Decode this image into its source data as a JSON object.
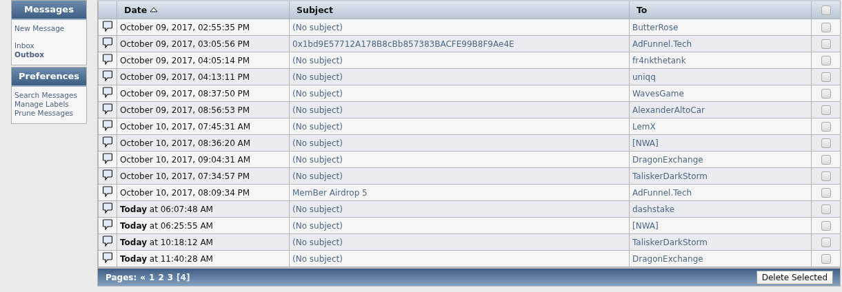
{
  "sidebar": {
    "sections": [
      {
        "title": "Messages",
        "groups": [
          [
            {
              "label": "New Message",
              "selected": false
            }
          ],
          [
            {
              "label": "Inbox",
              "selected": false
            },
            {
              "label": "Outbox",
              "selected": true
            }
          ]
        ]
      },
      {
        "title": "Preferences",
        "groups": [
          [
            {
              "label": "Search Messages",
              "selected": false
            },
            {
              "label": "Manage Labels",
              "selected": false
            },
            {
              "label": "Prune Messages",
              "selected": false
            }
          ]
        ]
      }
    ]
  },
  "table": {
    "columns": [
      {
        "label": "Date",
        "sorted": true
      },
      {
        "label": "Subject",
        "sorted": false
      },
      {
        "label": "To",
        "sorted": false
      }
    ],
    "select_all_checked": false,
    "rows": [
      {
        "date": "October 09, 2017, 02:55:35 PM",
        "subject": "(No subject)",
        "to": "ButterRose",
        "checked": false
      },
      {
        "date": "October 09, 2017, 03:05:56 PM",
        "subject": "0x1bd9E57712A178B8cBb857383BACFE99B8F9Ae4E",
        "to": "AdFunnel.Tech",
        "checked": false
      },
      {
        "date": "October 09, 2017, 04:05:14 PM",
        "subject": "(No subject)",
        "to": "fr4nkthetank",
        "checked": false
      },
      {
        "date": "October 09, 2017, 04:13:11 PM",
        "subject": "(No subject)",
        "to": "uniqq",
        "checked": false
      },
      {
        "date": "October 09, 2017, 08:37:50 PM",
        "subject": "(No subject)",
        "to": "WavesGame",
        "checked": false
      },
      {
        "date": "October 09, 2017, 08:56:53 PM",
        "subject": "(No subject)",
        "to": "AlexanderAltoCar",
        "checked": false
      },
      {
        "date": "October 10, 2017, 07:45:31 AM",
        "subject": "(No subject)",
        "to": "LemX",
        "checked": false
      },
      {
        "date": "October 10, 2017, 08:36:20 AM",
        "subject": "(No subject)",
        "to": "[NWA]",
        "checked": false
      },
      {
        "date": "October 10, 2017, 09:04:31 AM",
        "subject": "(No subject)",
        "to": "DragonExchange",
        "checked": false
      },
      {
        "date": "October 10, 2017, 07:34:57 PM",
        "subject": "(No subject)",
        "to": "TaliskerDarkStorm",
        "checked": false
      },
      {
        "date": "October 10, 2017, 08:09:34 PM",
        "subject": "MemBer Airdrop 5",
        "to": "AdFunnel.Tech",
        "checked": false
      },
      {
        "date": "**Today** at 06:07:48 AM",
        "subject": "(No subject)",
        "to": "dashstake",
        "checked": false
      },
      {
        "date": "**Today** at 06:25:55 AM",
        "subject": "(No subject)",
        "to": "[NWA]",
        "checked": false
      },
      {
        "date": "**Today** at 10:18:12 AM",
        "subject": "(No subject)",
        "to": "TaliskerDarkStorm",
        "checked": false
      },
      {
        "date": "**Today** at 11:40:28 AM",
        "subject": "(No subject)",
        "to": "DragonExchange",
        "checked": false
      }
    ]
  },
  "footer": {
    "pages_label": "Pages:",
    "pages": [
      {
        "label": "«",
        "selected": false
      },
      {
        "label": "1",
        "selected": false
      },
      {
        "label": "2",
        "selected": false
      },
      {
        "label": "3",
        "selected": false
      },
      {
        "label": "[4]",
        "selected": true
      }
    ],
    "delete_button": "Delete Selected"
  }
}
